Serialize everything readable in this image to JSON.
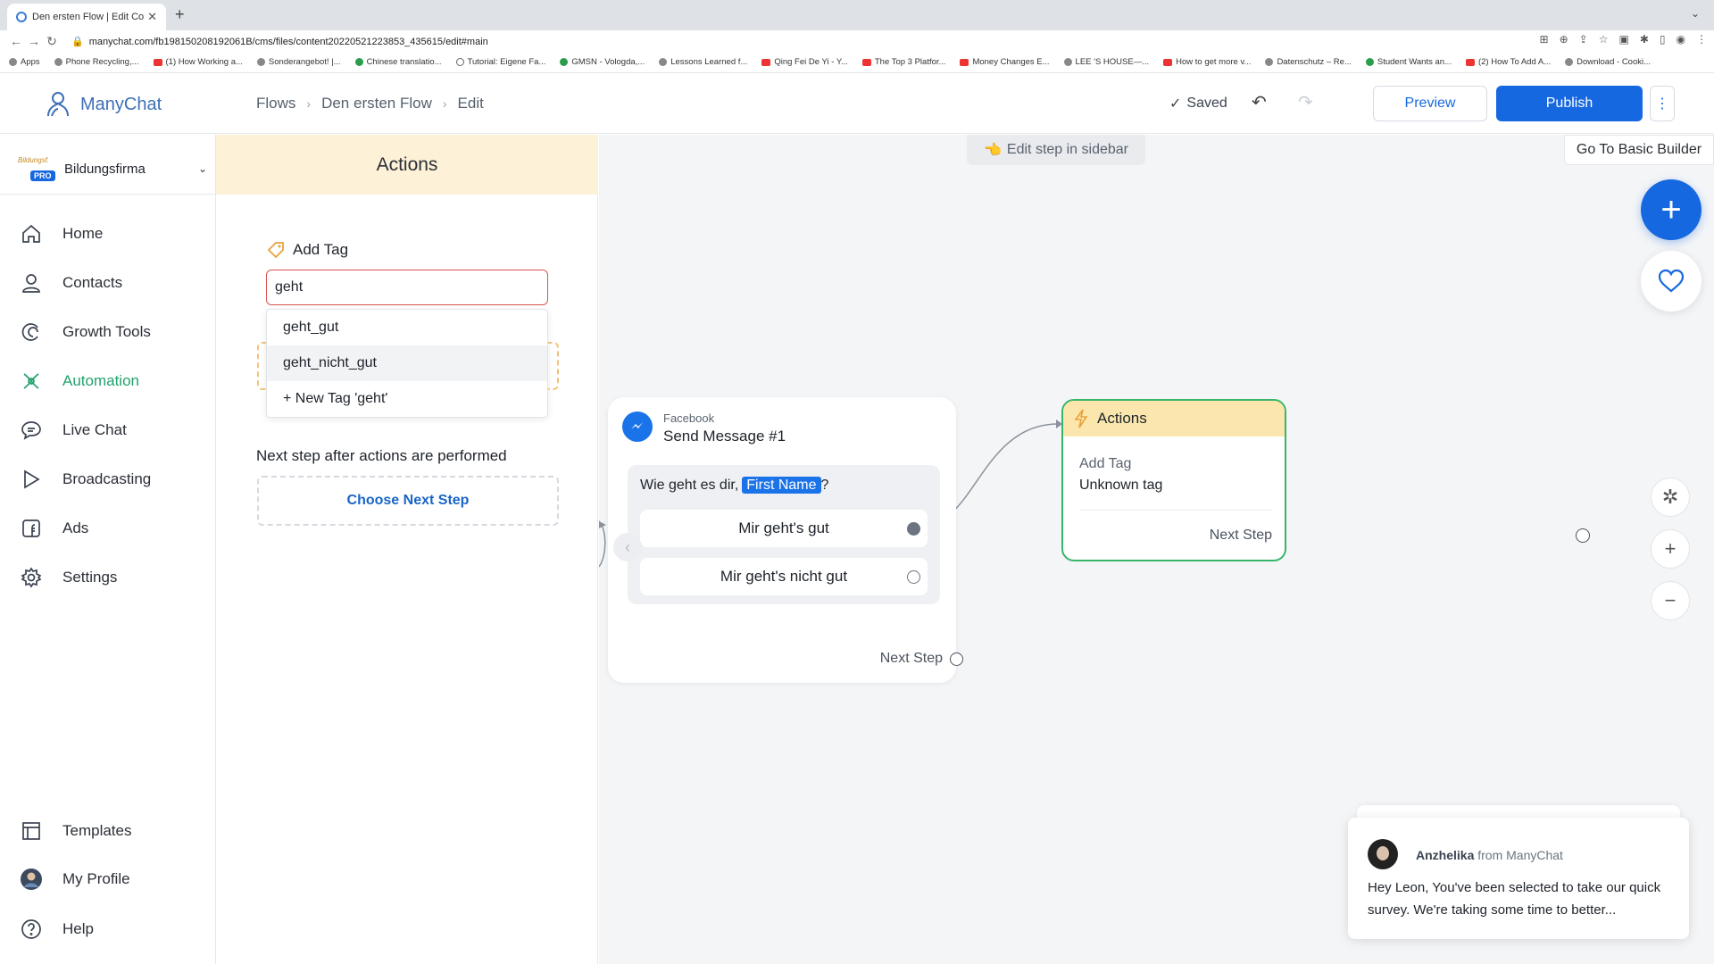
{
  "browser": {
    "tab_title": "Den ersten Flow | Edit Content",
    "url": "manychat.com/fb198150208192061B/cms/files/content20220521223853_435615/edit#main",
    "bookmarks": [
      {
        "label": "Apps",
        "icon": "grid"
      },
      {
        "label": "Phone Recycling,...",
        "icon": "circle"
      },
      {
        "label": "(1) How Working a...",
        "icon": "youtube"
      },
      {
        "label": "Sonderangebot! |...",
        "icon": "circle"
      },
      {
        "label": "Chinese translatio...",
        "icon": "green"
      },
      {
        "label": "Tutorial: Eigene Fa...",
        "icon": "hash"
      },
      {
        "label": "GMSN - Vologda,...",
        "icon": "green"
      },
      {
        "label": "Lessons Learned f...",
        "icon": "circle"
      },
      {
        "label": "Qing Fei De Yi - Y...",
        "icon": "youtube"
      },
      {
        "label": "The Top 3 Platfor...",
        "icon": "youtube"
      },
      {
        "label": "Money Changes E...",
        "icon": "youtube"
      },
      {
        "label": "LEE 'S HOUSE—...",
        "icon": "circle"
      },
      {
        "label": "How to get more v...",
        "icon": "youtube"
      },
      {
        "label": "Datenschutz – Re...",
        "icon": "circle"
      },
      {
        "label": "Student Wants an...",
        "icon": "green"
      },
      {
        "label": "(2) How To Add A...",
        "icon": "youtube"
      },
      {
        "label": "Download - Cooki...",
        "icon": "circle"
      }
    ]
  },
  "header": {
    "brand": "ManyChat",
    "breadcrumb": [
      "Flows",
      "Den ersten Flow",
      "Edit"
    ],
    "saved_label": "Saved",
    "preview_label": "Preview",
    "publish_label": "Publish"
  },
  "sidebar": {
    "account_name": "Bildungsfirma",
    "account_badge": "PRO",
    "items": [
      {
        "label": "Home",
        "icon": "home-icon"
      },
      {
        "label": "Contacts",
        "icon": "contacts-icon"
      },
      {
        "label": "Growth Tools",
        "icon": "growth-tools-icon"
      },
      {
        "label": "Automation",
        "icon": "automation-icon",
        "active": true
      },
      {
        "label": "Live Chat",
        "icon": "live-chat-icon"
      },
      {
        "label": "Broadcasting",
        "icon": "broadcasting-icon"
      },
      {
        "label": "Ads",
        "icon": "ads-icon"
      },
      {
        "label": "Settings",
        "icon": "settings-icon"
      }
    ],
    "bottom_items": [
      {
        "label": "Templates",
        "icon": "templates-icon"
      },
      {
        "label": "My Profile",
        "icon": "profile-avatar"
      },
      {
        "label": "Help",
        "icon": "help-icon"
      }
    ]
  },
  "panel": {
    "title": "Actions",
    "add_tag_label": "Add Tag",
    "tag_input_value": "geht",
    "dropdown_options": [
      "geht_gut",
      "geht_nicht_gut",
      "+ New Tag 'geht'"
    ],
    "hovered_option_index": 1,
    "next_step_label": "Next step after actions are performed",
    "choose_next_label": "Choose Next Step"
  },
  "canvas": {
    "hint": "Edit step in sidebar",
    "basic_builder_label": "Go To Basic Builder",
    "message_node": {
      "platform": "Facebook",
      "title": "Send Message #1",
      "text": "Wie geht es dir,",
      "variable": "First Name",
      "text_suffix": "?",
      "quick_replies": [
        "Mir geht's gut",
        "Mir geht's nicht gut"
      ],
      "next_step_label": "Next Step"
    },
    "actions_node": {
      "title": "Actions",
      "line1": "Add Tag",
      "line2": "Unknown tag",
      "next_step_label": "Next Step"
    }
  },
  "chat_widget": {
    "agent_name": "Anzhelika",
    "from_label": "from ManyChat",
    "message": "Hey Leon,  You've been selected to take our quick survey. We're taking some time to better..."
  },
  "colors": {
    "brand_blue": "#1668e0",
    "active_green": "#23a26d",
    "panel_header": "#fdf1d7",
    "node_border_green": "#37b56a",
    "error_red": "#d9534f"
  }
}
